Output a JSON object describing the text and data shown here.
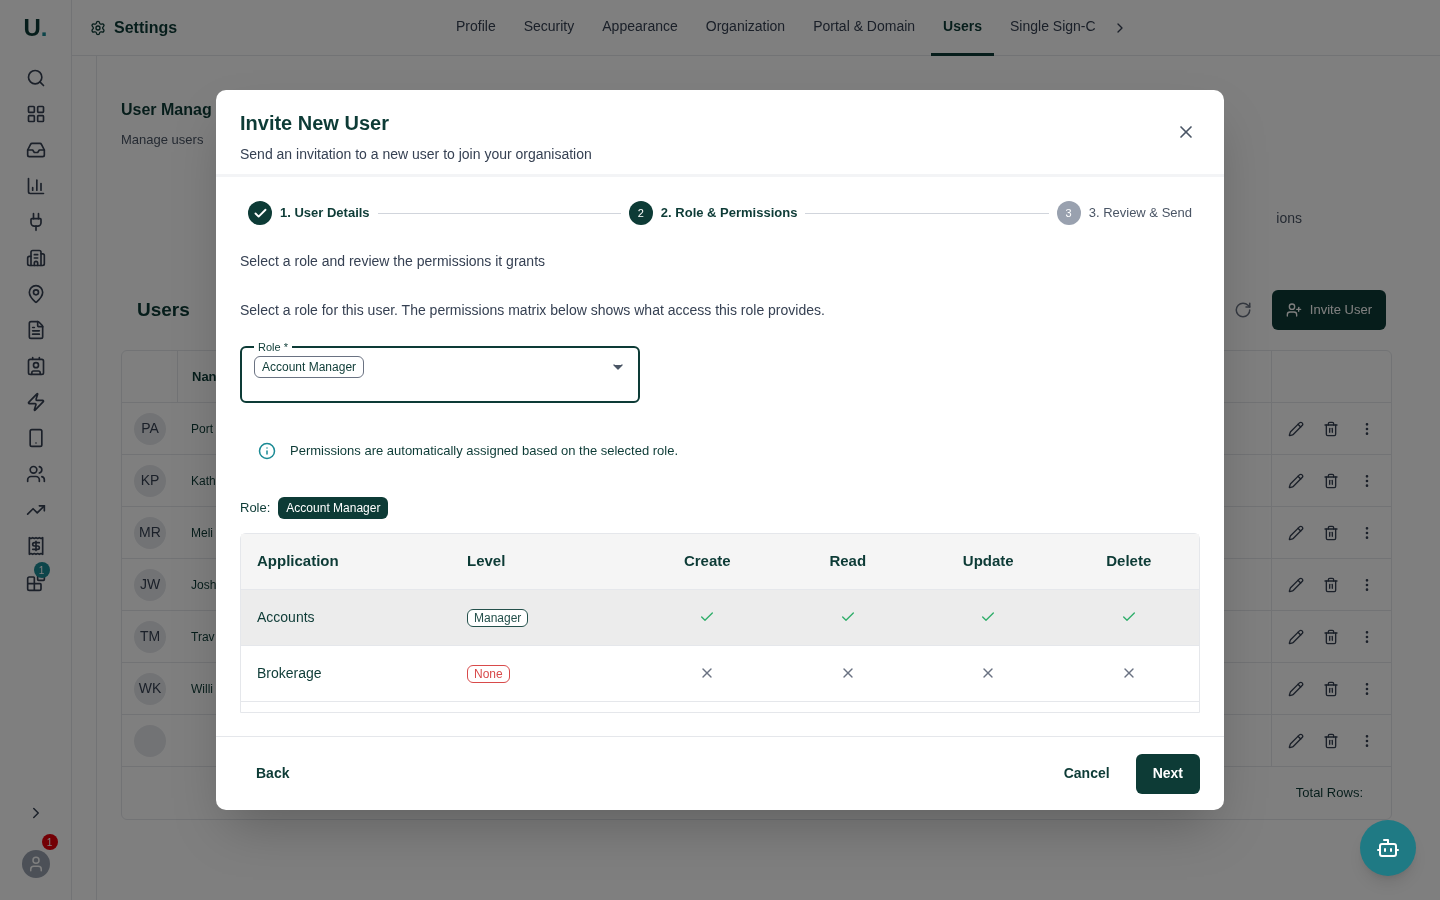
{
  "app": {
    "logo": "U",
    "logo_dot": ".",
    "sidebar": [
      {
        "kind": "search"
      },
      {
        "kind": "grid"
      },
      {
        "kind": "inbox"
      },
      {
        "kind": "chart"
      },
      {
        "kind": "plug"
      },
      {
        "kind": "building"
      },
      {
        "kind": "pins"
      },
      {
        "kind": "file"
      },
      {
        "kind": "contact"
      },
      {
        "kind": "zap"
      },
      {
        "kind": "phone"
      },
      {
        "kind": "users"
      },
      {
        "kind": "trend"
      },
      {
        "kind": "receipt"
      },
      {
        "kind": "blocks",
        "badge": "1"
      }
    ],
    "user_badge": "1",
    "header": {
      "title": "Settings",
      "tabs": [
        {
          "label": "Profile",
          "selected": false
        },
        {
          "label": "Security",
          "selected": false
        },
        {
          "label": "Appearance",
          "selected": false
        },
        {
          "label": "Organization",
          "selected": false
        },
        {
          "label": "Portal & Domain",
          "selected": false
        },
        {
          "label": "Users",
          "selected": true
        },
        {
          "label": "Single Sign-C",
          "selected": false
        }
      ]
    },
    "page": {
      "title": "User Manag",
      "subtitle": "Manage users",
      "side_text": "ions",
      "users_title": "Users",
      "invite_button": "Invite User",
      "name_header": "Nan",
      "total": "Total Rows:",
      "rows": [
        {
          "initials": "PA",
          "name": "Port"
        },
        {
          "initials": "KP",
          "name": "Kath"
        },
        {
          "initials": "MR",
          "name": "Meli"
        },
        {
          "initials": "JW",
          "name": "Josh"
        },
        {
          "initials": "TM",
          "name": "Trav"
        },
        {
          "initials": "WK",
          "name": "Willi"
        },
        {
          "initials": "",
          "name": ""
        }
      ]
    }
  },
  "dialog": {
    "title": "Invite New User",
    "subtitle": "Send an invitation to a new user to join your organisation",
    "steps": [
      {
        "label": "1. User Details",
        "kind": "done"
      },
      {
        "number": "2",
        "label": "2. Role & Permissions",
        "kind": "active"
      },
      {
        "number": "3",
        "label": "3. Review & Send",
        "kind": "pending"
      }
    ],
    "intro": "Select a role and review the permissions it grants",
    "hint": "Select a role for this user. The permissions matrix below shows what access this role provides.",
    "role_field": {
      "label": "Role *",
      "value": "Account Manager"
    },
    "info": "Permissions are automatically assigned based on the selected role.",
    "role_label": "Role:",
    "role_chip": "Account Manager",
    "table": {
      "columns": [
        "Application",
        "Level",
        "Create",
        "Read",
        "Update",
        "Delete"
      ],
      "rows": [
        {
          "application": "Accounts",
          "level": {
            "label": "Manager",
            "color": "#24504b"
          },
          "highlighted": true,
          "create": true,
          "read": true,
          "update": true,
          "delete": true
        },
        {
          "application": "Brokerage",
          "level": {
            "label": "None",
            "color": "#d84a4a"
          },
          "highlighted": false,
          "create": false,
          "read": false,
          "update": false,
          "delete": false
        }
      ]
    },
    "buttons": {
      "back": "Back",
      "cancel": "Cancel",
      "next": "Next"
    }
  }
}
